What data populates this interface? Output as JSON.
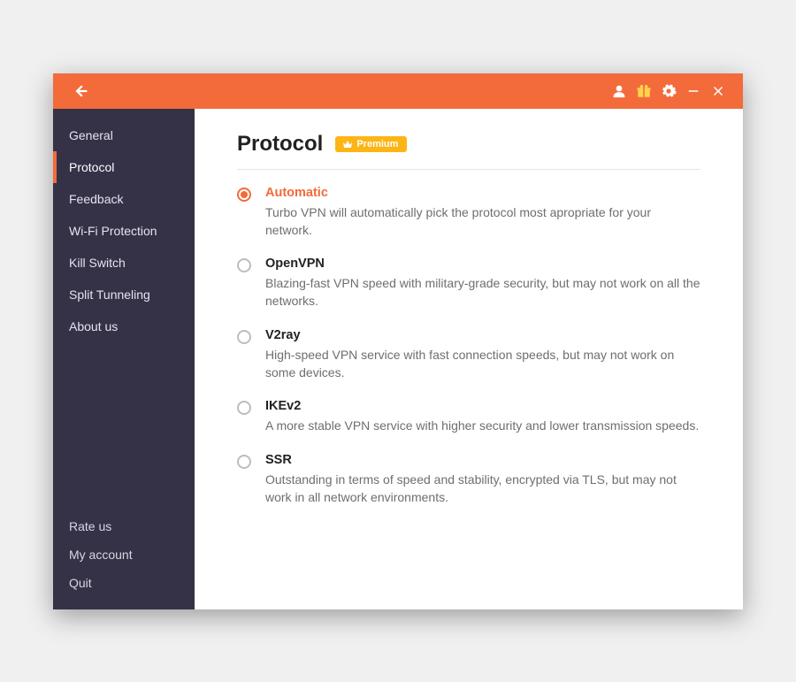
{
  "header": {
    "icons": [
      "back",
      "account",
      "gift",
      "settings",
      "minimize",
      "close"
    ]
  },
  "sidebar": {
    "items": [
      {
        "label": "General"
      },
      {
        "label": "Protocol",
        "active": true
      },
      {
        "label": "Feedback"
      },
      {
        "label": "Wi-Fi Protection"
      },
      {
        "label": "Kill Switch"
      },
      {
        "label": "Split Tunneling"
      },
      {
        "label": "About us"
      }
    ],
    "bottom": [
      {
        "label": "Rate us"
      },
      {
        "label": "My account"
      },
      {
        "label": "Quit"
      }
    ]
  },
  "page": {
    "title": "Protocol",
    "premium_label": "Premium"
  },
  "protocols": [
    {
      "title": "Automatic",
      "description": "Turbo VPN will automatically pick the protocol most apropriate for your network.",
      "selected": true
    },
    {
      "title": "OpenVPN",
      "description": "Blazing-fast VPN speed with military-grade security, but may not work on all the networks.",
      "selected": false
    },
    {
      "title": "V2ray",
      "description": "High-speed VPN service with fast connection speeds, but may not work on some devices.",
      "selected": false
    },
    {
      "title": "IKEv2",
      "description": "A more stable VPN service with higher security and lower transmission speeds.",
      "selected": false
    },
    {
      "title": "SSR",
      "description": "Outstanding in terms of speed and stability, encrypted via TLS, but may not work in all network environments.",
      "selected": false
    }
  ]
}
